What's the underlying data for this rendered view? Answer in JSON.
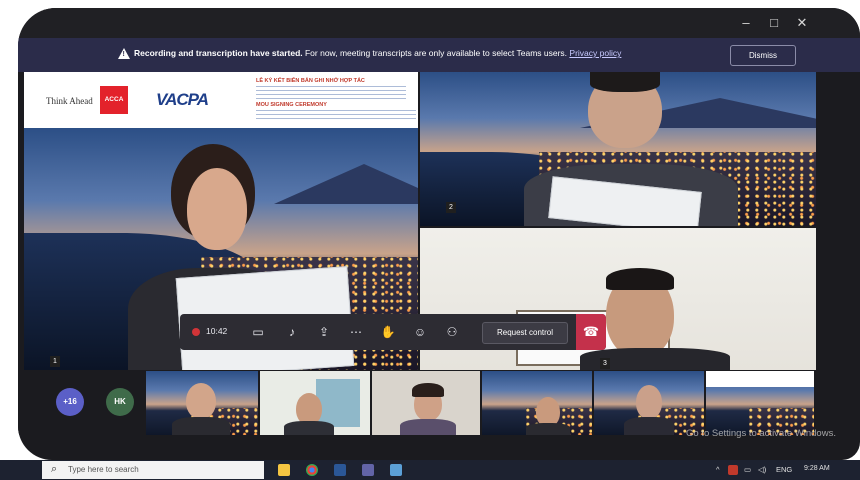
{
  "window_controls": {
    "minimize": "–",
    "maximize": "□",
    "close": "✕"
  },
  "banner": {
    "bold_text": "Recording and transcription have started.",
    "text": " For now, meeting transcripts are only available to select Teams users.",
    "link": "Privacy policy",
    "dismiss_label": "Dismiss"
  },
  "slide": {
    "brand_left": "Think Ahead",
    "brand_acca": "ACCA",
    "brand_vacpa": "VACPA",
    "text_lines": [
      "LỄ KÝ KẾT BIÊN BẢN GHI NHỚ HỢP TÁC",
      "MOU SIGNING CEREMONY"
    ]
  },
  "participant_numbers": {
    "top_right": "2",
    "main_left": "1",
    "bottom_right": "3"
  },
  "toolbar": {
    "timer": "10:42",
    "request_control_label": "Request control"
  },
  "strip": {
    "avatars": [
      {
        "initials": "+16",
        "color": "#5b5fc7"
      },
      {
        "initials": "HK",
        "color": "#3f6b4a"
      }
    ]
  },
  "watermark": "Go to Settings to activate Windows.",
  "taskbar": {
    "search_placeholder": "Type here to search",
    "tray_lang": "ENG",
    "tray_time": "9:28 AM"
  },
  "colors": {
    "banner": "#2b2c4a",
    "hangup": "#c4314b",
    "record": "#d13438",
    "acca": "#e3222b",
    "vacpa": "#1f3f8a"
  },
  "icons": [
    "record-dot-icon",
    "camera-icon",
    "mic-icon",
    "share-icon",
    "more-icon",
    "raise-hand-icon",
    "reaction-icon",
    "participants-icon",
    "hangup-icon"
  ]
}
